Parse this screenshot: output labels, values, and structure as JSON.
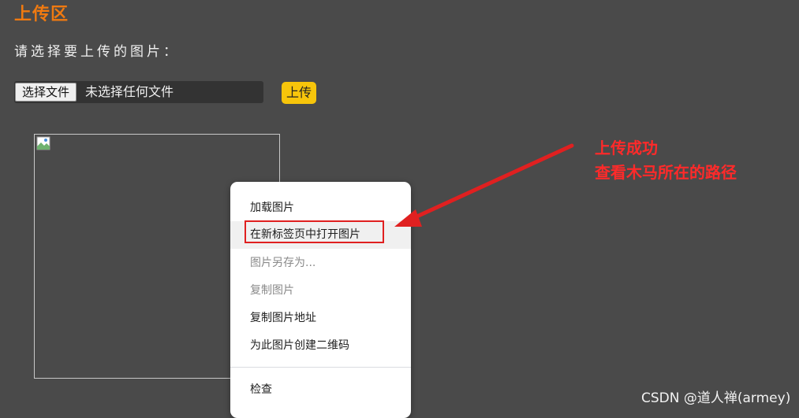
{
  "page": {
    "title": "上传区",
    "instruction": "请选择要上传的图片："
  },
  "file_picker": {
    "button_label": "选择文件",
    "status": "未选择任何文件"
  },
  "upload_button": {
    "label": "上传"
  },
  "context_menu": {
    "items": [
      {
        "label": "加载图片",
        "state": "enabled"
      },
      {
        "label": "在新标签页中打开图片",
        "state": "highlighted"
      },
      {
        "label": "图片另存为...",
        "state": "disabled"
      },
      {
        "label": "复制图片",
        "state": "disabled"
      },
      {
        "label": "复制图片地址",
        "state": "enabled"
      },
      {
        "label": "为此图片创建二维码",
        "state": "enabled"
      },
      {
        "label": "检查",
        "state": "enabled"
      }
    ]
  },
  "annotation": {
    "line1": "上传成功",
    "line2": "查看木马所在的路径",
    "color": "#ff2a2a"
  },
  "watermark": {
    "text": "CSDN @道人禅(armey)"
  },
  "colors": {
    "background": "#4a4a4a",
    "title": "#f07a10",
    "upload_button": "#f7c50b",
    "highlight_box": "#e02020"
  },
  "icons": {
    "broken_image": "broken-image-icon"
  }
}
